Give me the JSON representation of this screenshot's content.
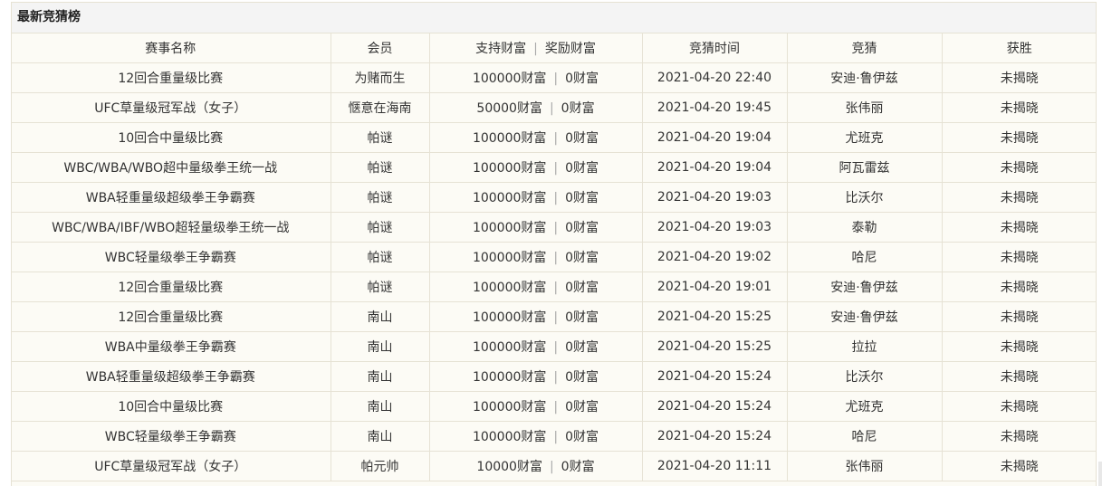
{
  "panel": {
    "title": "最新竞猜榜"
  },
  "columns": {
    "event": "赛事名称",
    "member": "会员",
    "bet": "支持财富",
    "reward": "奖励财富",
    "time": "竞猜时间",
    "guess": "竞猜",
    "result": "获胜",
    "separator": "|"
  },
  "rows": [
    {
      "event": "12回合重量级比赛",
      "member": "为赌而生",
      "bet": "100000财富",
      "reward": "0财富",
      "time": "2021-04-20 22:40",
      "guess": "安迪·鲁伊兹",
      "result": "未揭晓"
    },
    {
      "event": "UFC草量级冠军战（女子）",
      "member": "惬意在海南",
      "bet": "50000财富",
      "reward": "0财富",
      "time": "2021-04-20 19:45",
      "guess": "张伟丽",
      "result": "未揭晓"
    },
    {
      "event": "10回合中量级比赛",
      "member": "帕谜",
      "bet": "100000财富",
      "reward": "0财富",
      "time": "2021-04-20 19:04",
      "guess": "尤班克",
      "result": "未揭晓"
    },
    {
      "event": "WBC/WBA/WBO超中量级拳王统一战",
      "member": "帕谜",
      "bet": "100000财富",
      "reward": "0财富",
      "time": "2021-04-20 19:04",
      "guess": "阿瓦雷兹",
      "result": "未揭晓"
    },
    {
      "event": "WBA轻重量级超级拳王争霸赛",
      "member": "帕谜",
      "bet": "100000财富",
      "reward": "0财富",
      "time": "2021-04-20 19:03",
      "guess": "比沃尔",
      "result": "未揭晓"
    },
    {
      "event": "WBC/WBA/IBF/WBO超轻量级拳王统一战",
      "member": "帕谜",
      "bet": "100000财富",
      "reward": "0财富",
      "time": "2021-04-20 19:03",
      "guess": "泰勒",
      "result": "未揭晓"
    },
    {
      "event": "WBC轻量级拳王争霸赛",
      "member": "帕谜",
      "bet": "100000财富",
      "reward": "0财富",
      "time": "2021-04-20 19:02",
      "guess": "哈尼",
      "result": "未揭晓"
    },
    {
      "event": "12回合重量级比赛",
      "member": "帕谜",
      "bet": "100000财富",
      "reward": "0财富",
      "time": "2021-04-20 19:01",
      "guess": "安迪·鲁伊兹",
      "result": "未揭晓"
    },
    {
      "event": "12回合重量级比赛",
      "member": "南山",
      "bet": "100000财富",
      "reward": "0财富",
      "time": "2021-04-20 15:25",
      "guess": "安迪·鲁伊兹",
      "result": "未揭晓"
    },
    {
      "event": "WBA中量级拳王争霸赛",
      "member": "南山",
      "bet": "100000财富",
      "reward": "0财富",
      "time": "2021-04-20 15:25",
      "guess": "拉拉",
      "result": "未揭晓"
    },
    {
      "event": "WBA轻重量级超级拳王争霸赛",
      "member": "南山",
      "bet": "100000财富",
      "reward": "0财富",
      "time": "2021-04-20 15:24",
      "guess": "比沃尔",
      "result": "未揭晓"
    },
    {
      "event": "10回合中量级比赛",
      "member": "南山",
      "bet": "100000财富",
      "reward": "0财富",
      "time": "2021-04-20 15:24",
      "guess": "尤班克",
      "result": "未揭晓"
    },
    {
      "event": "WBC轻量级拳王争霸赛",
      "member": "南山",
      "bet": "100000财富",
      "reward": "0财富",
      "time": "2021-04-20 15:24",
      "guess": "哈尼",
      "result": "未揭晓"
    },
    {
      "event": "UFC草量级冠军战（女子）",
      "member": "帕元帅",
      "bet": "10000财富",
      "reward": "0财富",
      "time": "2021-04-20 11:11",
      "guess": "张伟丽",
      "result": "未揭晓"
    }
  ]
}
